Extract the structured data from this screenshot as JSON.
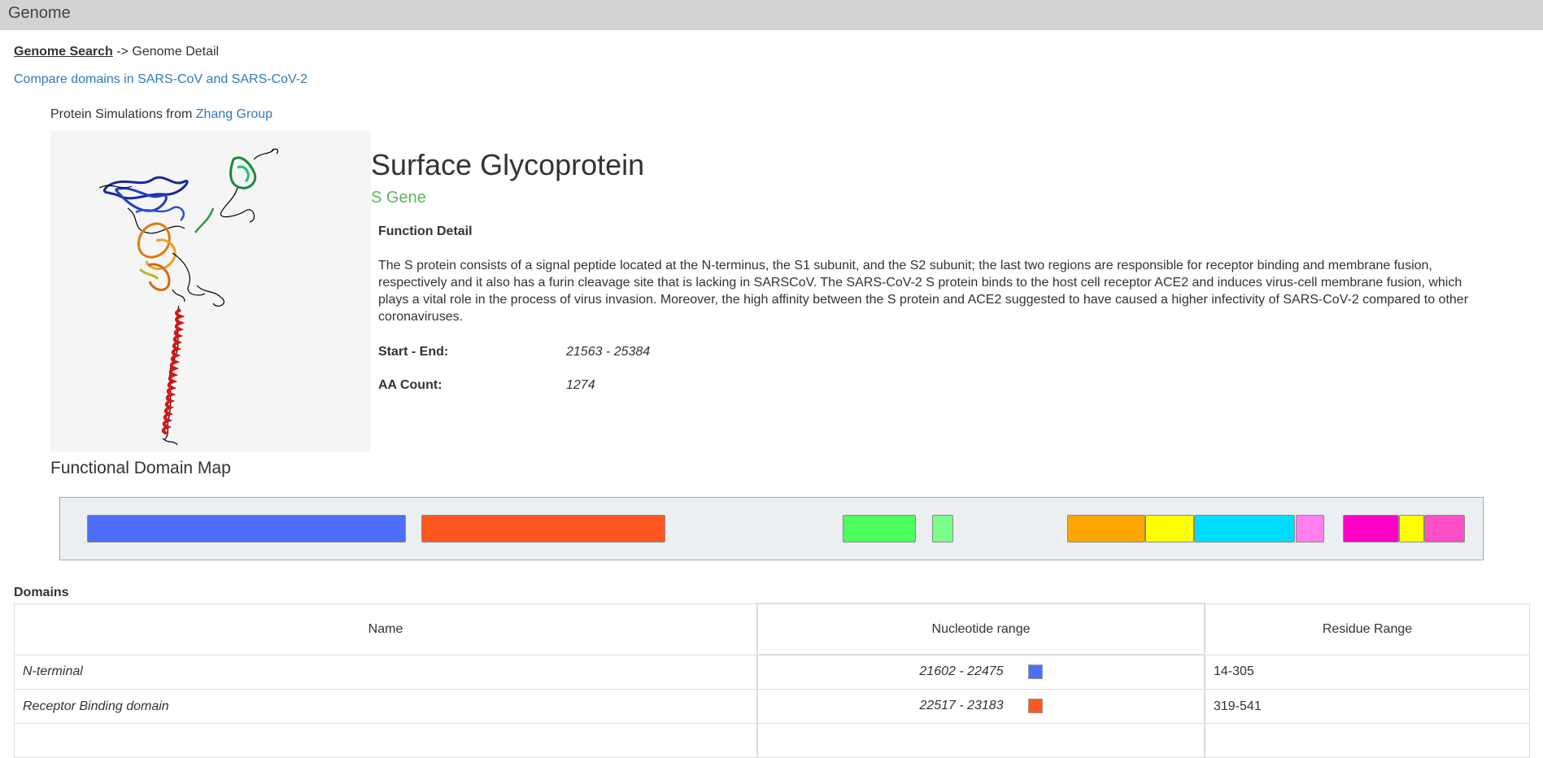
{
  "header": {
    "title": "Genome"
  },
  "breadcrumb": {
    "link": "Genome Search",
    "separator": " -> ",
    "current": "Genome Detail"
  },
  "compare_link": "Compare domains in SARS-CoV and SARS-CoV-2",
  "simulation": {
    "prefix": "Protein Simulations from ",
    "link": "Zhang Group"
  },
  "gene": {
    "title": "Surface Glycoprotein",
    "subtitle": "S Gene",
    "function_heading": "Function Detail",
    "function_text": "The S protein consists of a signal peptide located at the N-terminus, the S1 subunit, and the S2 subunit; the last two regions are responsible for receptor binding and membrane fusion, respectively and it also has a furin cleavage site that is lacking in SARSCoV. The SARS-CoV-2 S protein binds to the host cell receptor ACE2 and induces virus-cell membrane fusion, which plays a vital role in the process of virus invasion. Moreover, the high affinity between the S protein and ACE2 suggested to have caused a higher infectivity of SARS-CoV-2 compared to other coronaviruses.",
    "start_end_label": "Start - End:",
    "start_end_value": "21563 - 25384",
    "aa_count_label": "AA Count:",
    "aa_count_value": "1274"
  },
  "domain_map": {
    "title": "Functional Domain Map",
    "gene_start": 21563,
    "gene_end": 25384,
    "segments": [
      {
        "start": 21602,
        "end": 22475,
        "color": "#4f6ef7"
      },
      {
        "start": 22517,
        "end": 23183,
        "color": "#ff5722"
      },
      {
        "start": 23669,
        "end": 23868,
        "color": "#4cff5a"
      },
      {
        "start": 23912,
        "end": 23970,
        "color": "#7aff8a"
      },
      {
        "start": 24281,
        "end": 24494,
        "color": "#ffa500"
      },
      {
        "start": 24494,
        "end": 24629,
        "color": "#ffff00"
      },
      {
        "start": 24629,
        "end": 24905,
        "color": "#00dcff"
      },
      {
        "start": 24905,
        "end": 24983,
        "color": "#ff80ee"
      },
      {
        "start": 25036,
        "end": 25189,
        "color": "#ff00c8"
      },
      {
        "start": 25189,
        "end": 25257,
        "color": "#ffff00"
      },
      {
        "start": 25257,
        "end": 25368,
        "color": "#ff50c8"
      }
    ]
  },
  "domains_table": {
    "label": "Domains",
    "headers": [
      "Name",
      "Nucleotide range",
      "Residue Range"
    ],
    "rows": [
      {
        "name": "N-terminal",
        "nucleotide_range": "21602 - 22475",
        "residue_range": "14-305",
        "color": "#4f6ef7"
      },
      {
        "name": "Receptor Binding domain",
        "nucleotide_range": "22517 - 23183",
        "residue_range": "319-541",
        "color": "#ff5722"
      }
    ]
  }
}
